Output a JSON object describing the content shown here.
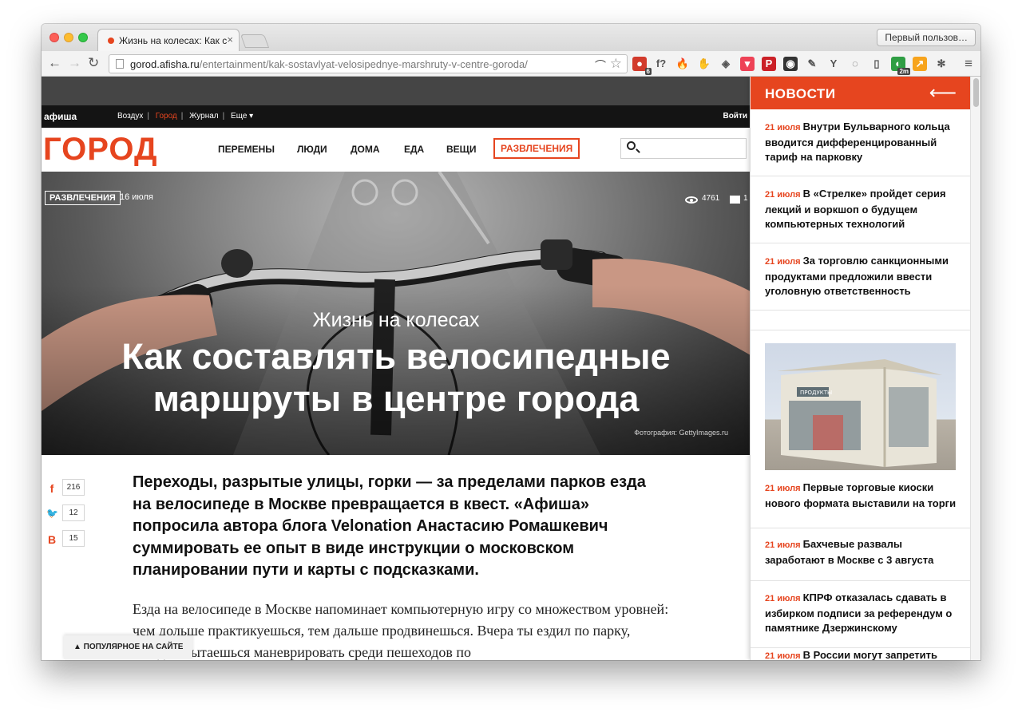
{
  "browser": {
    "tab_title": "Жизнь на колесах: Как со",
    "tab_close": "×",
    "profile_button": "Первый пользов…",
    "url_host": "gorod.afisha.ru",
    "url_path": "/entertainment/kak-sostavlyat-velosipednye-marshruty-v-centre-goroda/",
    "back": "←",
    "forward": "→",
    "reload": "↻",
    "star": "☆",
    "menu": "≡",
    "extensions": [
      {
        "name": "adblock-icon",
        "glyph": "●",
        "badge": "6",
        "color": "#d23b2c"
      },
      {
        "name": "font-icon",
        "glyph": "f?",
        "badge": "",
        "color": "transparent"
      },
      {
        "name": "fire-icon",
        "glyph": "🔥",
        "badge": "",
        "color": "transparent"
      },
      {
        "name": "evernote-icon",
        "glyph": "✋",
        "badge": "",
        "color": "transparent"
      },
      {
        "name": "shield-icon",
        "glyph": "◈",
        "badge": "",
        "color": "transparent"
      },
      {
        "name": "pocket-icon",
        "glyph": "▾",
        "badge": "",
        "color": "#ee4256"
      },
      {
        "name": "pinterest-icon",
        "glyph": "P",
        "badge": "",
        "color": "#cb2027"
      },
      {
        "name": "camera-icon",
        "glyph": "◉",
        "badge": "",
        "color": "#333333"
      },
      {
        "name": "dropper-icon",
        "glyph": "✎",
        "badge": "",
        "color": "transparent"
      },
      {
        "name": "y-icon",
        "glyph": "Y",
        "badge": "",
        "color": "transparent"
      },
      {
        "name": "refresh-ext-icon",
        "glyph": "◌",
        "badge": "",
        "color": "transparent"
      },
      {
        "name": "book-icon",
        "glyph": "▯",
        "badge": "",
        "color": "transparent"
      },
      {
        "name": "timer-icon",
        "glyph": "◐",
        "badge": "2m",
        "color": "#2f9e44"
      },
      {
        "name": "chart-icon",
        "glyph": "↗",
        "badge": "",
        "color": "#f7a41d"
      },
      {
        "name": "paw-icon",
        "glyph": "✻",
        "badge": "",
        "color": "transparent"
      }
    ]
  },
  "site": {
    "afisha_logo": "афиша",
    "nav": [
      "Воздух",
      "Город",
      "Журнал",
      "Еще ▾"
    ],
    "nav_sep": "|",
    "login": "Войти",
    "logo": "ГОРОД",
    "main_nav": [
      "ПЕРЕМЕНЫ",
      "ЛЮДИ",
      "ДОМА",
      "ЕДА",
      "ВЕЩИ",
      "РАЗВЛЕЧЕНИЯ"
    ],
    "accent": "#e6451f"
  },
  "hero": {
    "badge": "РАЗВЛЕЧЕНИЯ",
    "date": "16 июля",
    "views": "4761",
    "comments": "1",
    "subtitle": "Жизнь на колесах",
    "title_line1": "Как составлять велосипедные",
    "title_line2": "маршруты в центре города",
    "credit": "Фотография: GettyImages.ru"
  },
  "share": [
    {
      "icon": "facebook-icon",
      "glyph": "f",
      "count": "216"
    },
    {
      "icon": "twitter-icon",
      "glyph": "🐦",
      "count": "12"
    },
    {
      "icon": "vk-icon",
      "glyph": "В",
      "count": "15"
    }
  ],
  "article": {
    "lead": "Переходы, разрытые улицы, горки — за пределами парков езда на велосипеде в Москве превращается в квест. «Афиша» попросила автора блога Velonation Анастасию Ромашкевич суммировать ее опыт в виде инструкции о московском планировании пути и карты с подсказками.",
    "body": "Езда на велосипеде в Москве напоминает компьютерную игру со множеством уровней: чем дольше практикуешься, тем дальше продвинешься. Вчера ты ездил по парку, сегодня пытаешься маневрировать среди пешеходов по",
    "popular": "▲  ПОПУЛЯРНОЕ НА САЙТЕ"
  },
  "news": {
    "title": "НОВОСТИ",
    "back": "⟵",
    "items": [
      {
        "date": "21 июля",
        "text": "Внутри Бульварного кольца вводится дифференцированный тариф на парковку"
      },
      {
        "date": "21 июля",
        "text": "В «Стрелке» пройдет серия лекций и воркшоп о будущем компьютерных технологий"
      },
      {
        "date": "21 июля",
        "text": "За торговлю санкционными продуктами предложили ввести уголовную ответственность"
      },
      {
        "date": "21 июля",
        "text": "Первые торговые киоски нового формата выставили на торги"
      },
      {
        "date": "21 июля",
        "text": "Бахчевые развалы заработают в Москве с 3 августа"
      },
      {
        "date": "21 июля",
        "text": "КПРФ отказалась сдавать в избирком подписи за референдум о памятнике Дзержинскому"
      },
      {
        "date": "21 июля",
        "text": "В России могут запретить"
      }
    ],
    "kiosk_sign": "ПРОДУКТЫ"
  }
}
